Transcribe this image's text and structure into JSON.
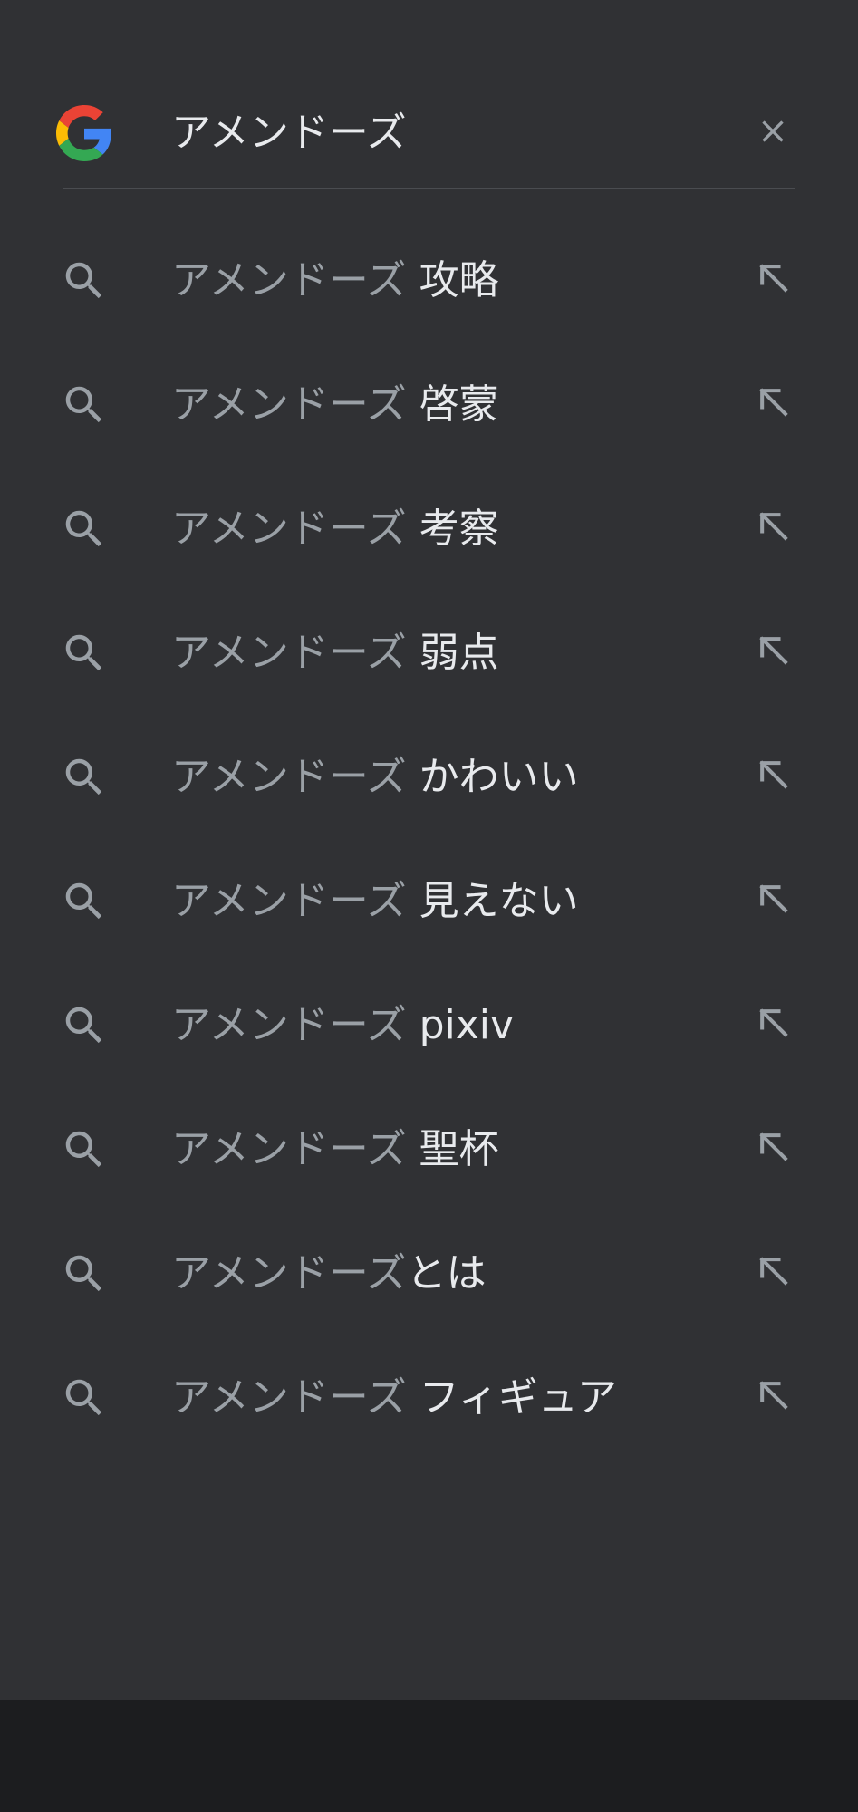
{
  "search": {
    "query": "アメンドーズ",
    "logo_icon": "google-g-icon",
    "clear_icon": "close-icon"
  },
  "suggestions": [
    {
      "prefix": "アメンドーズ",
      "completion": " 攻略",
      "icon": "search-icon",
      "fill_icon": "arrow-up-left-icon"
    },
    {
      "prefix": "アメンドーズ",
      "completion": " 啓蒙",
      "icon": "search-icon",
      "fill_icon": "arrow-up-left-icon"
    },
    {
      "prefix": "アメンドーズ",
      "completion": " 考察",
      "icon": "search-icon",
      "fill_icon": "arrow-up-left-icon"
    },
    {
      "prefix": "アメンドーズ",
      "completion": " 弱点",
      "icon": "search-icon",
      "fill_icon": "arrow-up-left-icon"
    },
    {
      "prefix": "アメンドーズ",
      "completion": " かわいい",
      "icon": "search-icon",
      "fill_icon": "arrow-up-left-icon"
    },
    {
      "prefix": "アメンドーズ",
      "completion": " 見えない",
      "icon": "search-icon",
      "fill_icon": "arrow-up-left-icon"
    },
    {
      "prefix": "アメンドーズ",
      "completion": " pixiv",
      "icon": "search-icon",
      "fill_icon": "arrow-up-left-icon"
    },
    {
      "prefix": "アメンドーズ",
      "completion": " 聖杯",
      "icon": "search-icon",
      "fill_icon": "arrow-up-left-icon"
    },
    {
      "prefix": "アメンドーズ",
      "completion": "とは",
      "icon": "search-icon",
      "fill_icon": "arrow-up-left-icon"
    },
    {
      "prefix": "アメンドーズ",
      "completion": " フィギュア",
      "icon": "search-icon",
      "fill_icon": "arrow-up-left-icon"
    }
  ],
  "colors": {
    "background": "#303134",
    "nav_bar": "#1c1d1f",
    "query_text": "#e8eaed",
    "prefix_text": "#9aa0a6",
    "completion_text": "#e8eaed",
    "icon": "#9aa0a6",
    "divider": "#4a4c50",
    "google_blue": "#4285F4",
    "google_red": "#EA4335",
    "google_yellow": "#FBBC05",
    "google_green": "#34A853"
  }
}
